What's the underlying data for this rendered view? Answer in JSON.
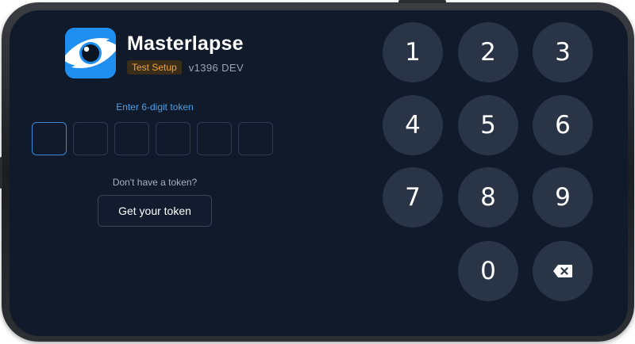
{
  "app": {
    "name": "Masterlapse",
    "env_badge": "Test Setup",
    "version": "v1396",
    "build": "DEV",
    "logo_icon": "eye-logo-icon",
    "accent_color": "#1e8ef0",
    "badge_color": "#f0a23a"
  },
  "token": {
    "label": "Enter 6-digit token",
    "digits": [
      "",
      "",
      "",
      "",
      "",
      ""
    ],
    "active_index": 0
  },
  "help": {
    "no_token_text": "Don't have a token?",
    "get_token_label": "Get your token"
  },
  "keypad": {
    "keys": [
      "1",
      "2",
      "3",
      "4",
      "5",
      "6",
      "7",
      "8",
      "9",
      "0"
    ],
    "backspace_icon": "backspace-icon"
  }
}
